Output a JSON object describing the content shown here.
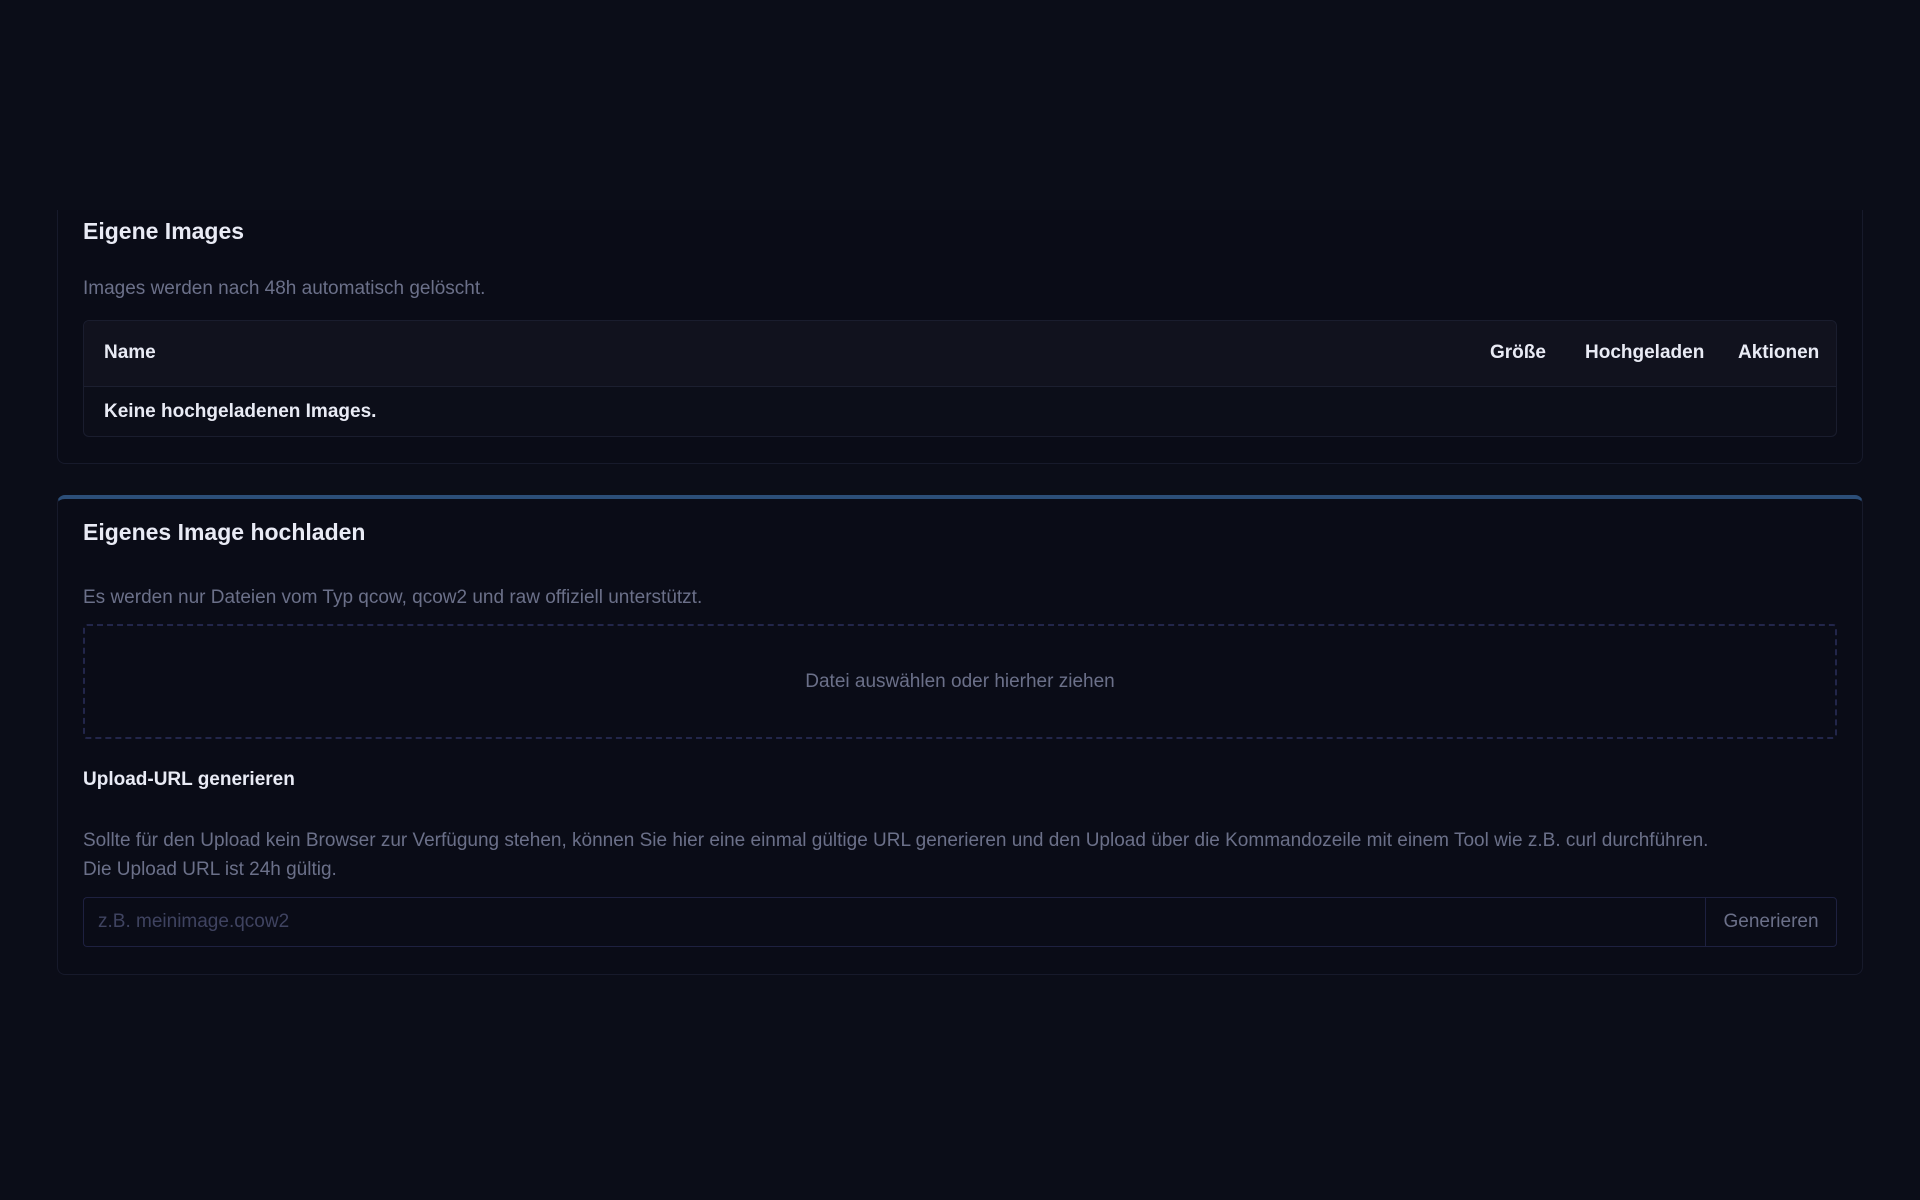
{
  "images_card": {
    "title": "Eigene Images",
    "subtitle": "Images werden nach 48h automatisch gelöscht.",
    "table": {
      "columns": [
        "Name",
        "Größe",
        "Hochgeladen",
        "Aktionen"
      ],
      "empty_text": "Keine hochgeladenen Images."
    }
  },
  "upload_card": {
    "title": "Eigenes Image hochladen",
    "subtitle": "Es werden nur Dateien vom Typ qcow, qcow2 und raw offiziell unterstützt.",
    "dropzone_label": "Datei auswählen oder hierher ziehen",
    "url_section": {
      "title": "Upload-URL generieren",
      "description_line1": "Sollte für den Upload kein Browser zur Verfügung stehen, können Sie hier eine einmal gültige URL generieren und den Upload über die Kommandozeile mit einem Tool wie z.B. curl durchführen.",
      "description_line2": "Die Upload URL ist 24h gültig.",
      "input_placeholder": "z.B. meinimage.qcow2",
      "input_value": "",
      "button_label": "Generieren"
    }
  },
  "colors": {
    "background": "#0b0d18",
    "card_accent": "#2c4e78",
    "muted_text": "#6b7089"
  }
}
